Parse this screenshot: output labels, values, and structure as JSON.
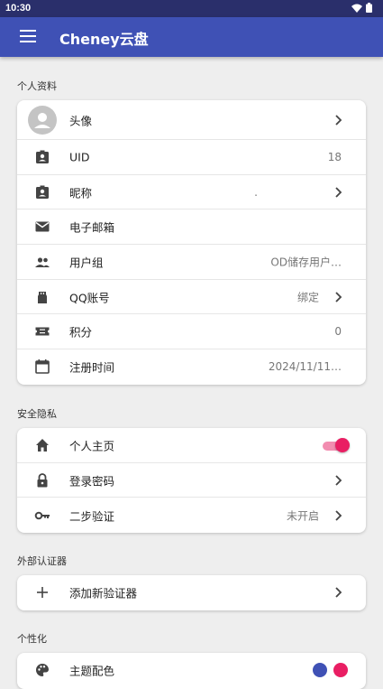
{
  "status_bar": {
    "time": "10:30"
  },
  "app_bar": {
    "title": "Cheney云盘"
  },
  "sections": {
    "profile": {
      "title": "个人资料",
      "rows": [
        {
          "label": "头像"
        },
        {
          "label": "UID",
          "value": "18"
        },
        {
          "label": "昵称",
          "value": "."
        },
        {
          "label": "电子邮箱",
          "value": ""
        },
        {
          "label": "用户组",
          "value": "OD储存用户…"
        },
        {
          "label": "QQ账号",
          "value": "绑定"
        },
        {
          "label": "积分",
          "value": "0"
        },
        {
          "label": "注册时间",
          "value": "2024/11/11…"
        }
      ]
    },
    "security": {
      "title": "安全隐私",
      "rows": [
        {
          "label": "个人主页",
          "toggle_on": true
        },
        {
          "label": "登录密码"
        },
        {
          "label": "二步验证",
          "value": "未开启"
        }
      ]
    },
    "authenticator": {
      "title": "外部认证器",
      "rows": [
        {
          "label": "添加新验证器"
        }
      ]
    },
    "personalize": {
      "title": "个性化",
      "rows": [
        {
          "label": "主题配色"
        }
      ]
    }
  },
  "icons": {
    "uid": "badge-icon",
    "nickname": "contact-icon",
    "email": "mail-icon",
    "group": "group-icon",
    "qq": "qq-icon",
    "points": "ticket-icon",
    "register": "calendar-icon",
    "homepage": "home-icon",
    "password": "lock-icon",
    "twofa": "key-icon",
    "add": "plus-icon",
    "theme": "palette-icon"
  },
  "colors": {
    "primary": "#3f51b5",
    "accent": "#e91e63",
    "status_bar": "#2a2f6b",
    "theme_primary": "#3f51b5",
    "theme_accent": "#e91e63"
  }
}
